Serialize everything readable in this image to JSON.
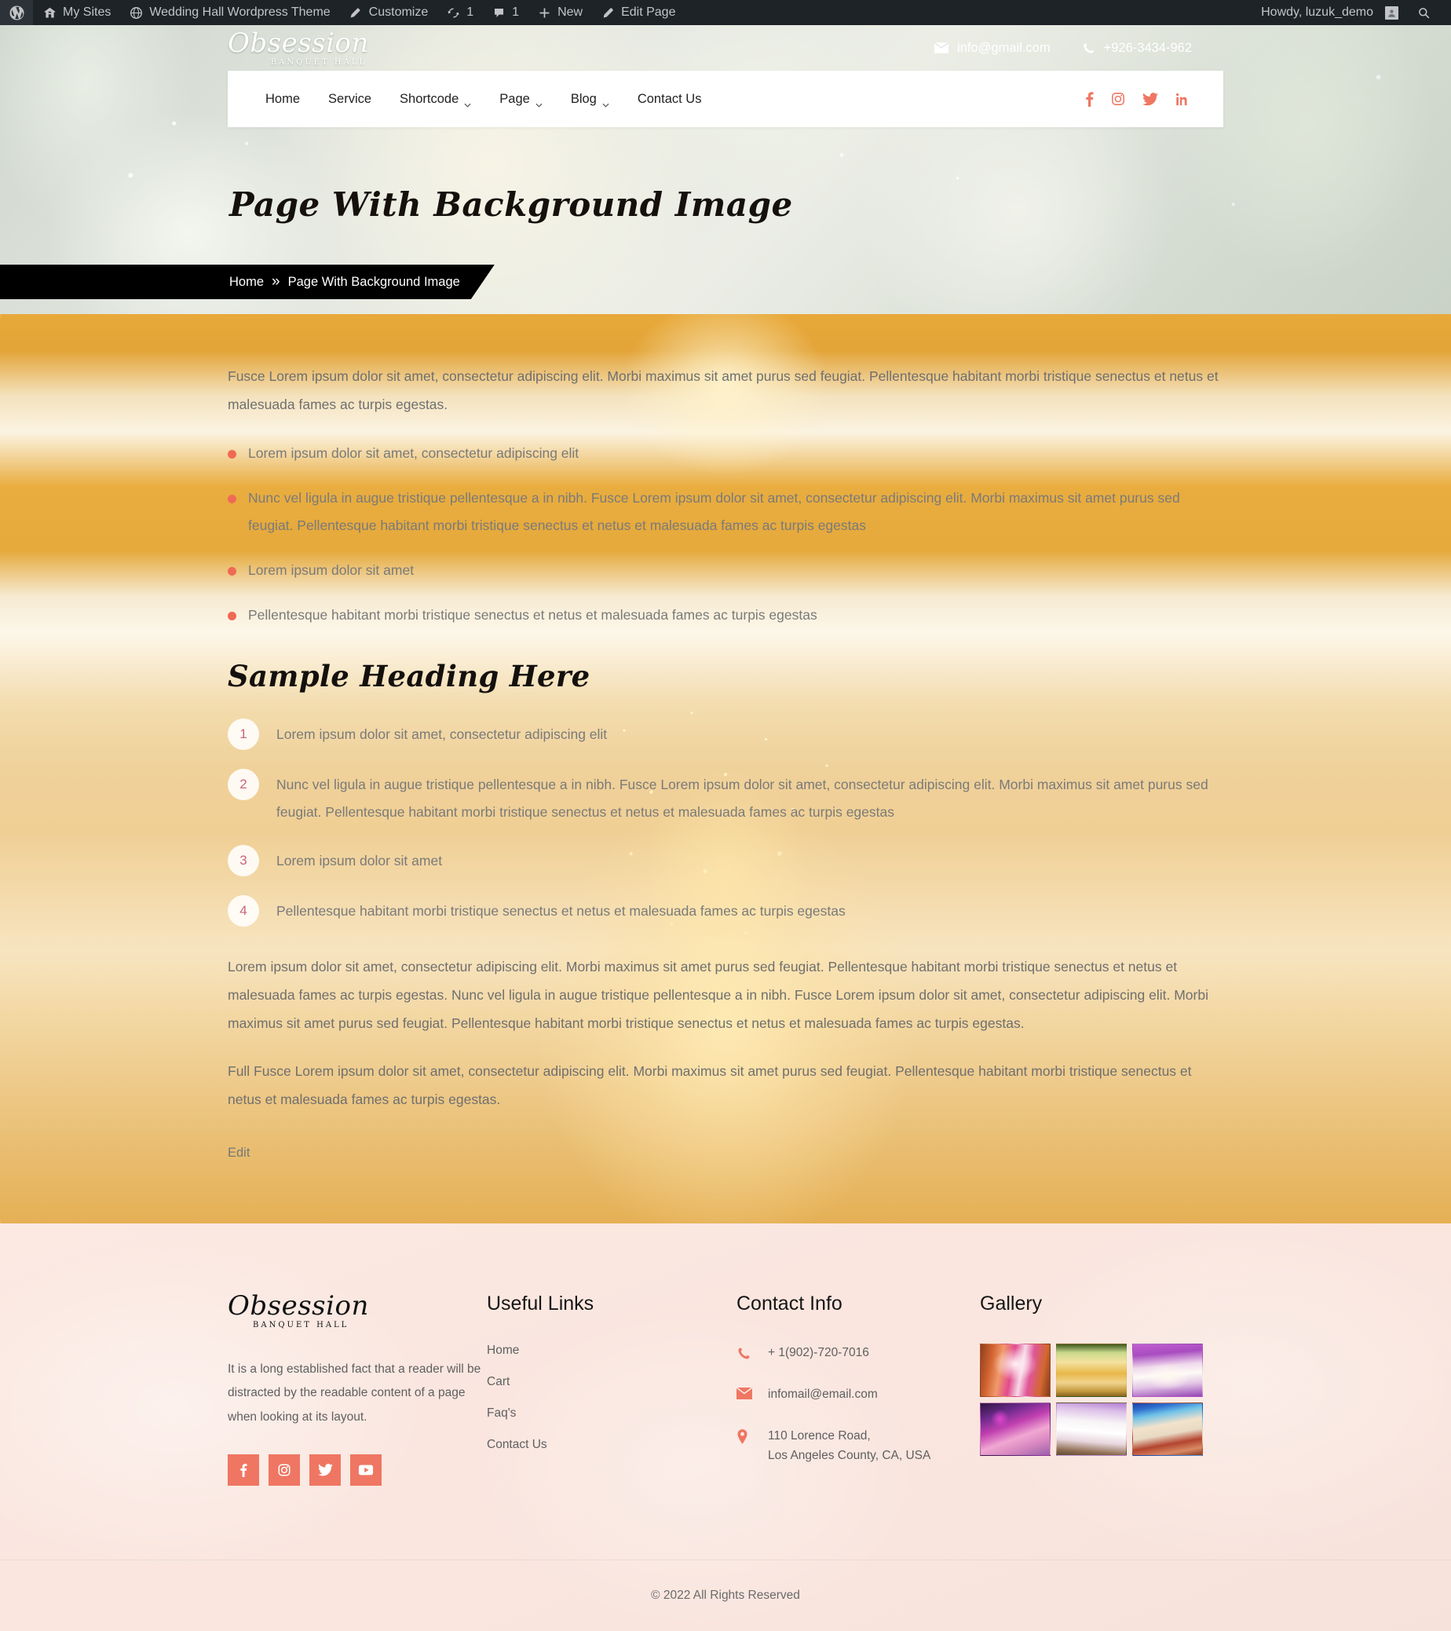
{
  "adminbar": {
    "items": [
      {
        "icon": "wordpress-icon",
        "label": ""
      },
      {
        "icon": "sites-icon",
        "label": "My Sites"
      },
      {
        "icon": "site-icon",
        "label": "Wedding Hall Wordpress Theme"
      },
      {
        "icon": "customize-icon",
        "label": "Customize"
      },
      {
        "icon": "updates-icon",
        "label": "1"
      },
      {
        "icon": "comments-icon",
        "label": "1"
      },
      {
        "icon": "plus-icon",
        "label": "New"
      },
      {
        "icon": "pencil-icon",
        "label": "Edit Page"
      }
    ],
    "howdy": "Howdy, luzuk_demo",
    "search_icon": "search-icon"
  },
  "header": {
    "logo_main": "Obsession",
    "logo_sub": "BANQUET HALL",
    "email": "info@gmail.com",
    "phone": "+926-3434-962",
    "menu": [
      {
        "label": "Home",
        "has_dropdown": false
      },
      {
        "label": "Service",
        "has_dropdown": false
      },
      {
        "label": "Shortcode",
        "has_dropdown": true
      },
      {
        "label": "Page",
        "has_dropdown": true
      },
      {
        "label": "Blog",
        "has_dropdown": true
      },
      {
        "label": "Contact Us",
        "has_dropdown": false
      }
    ],
    "social": [
      "facebook-icon",
      "instagram-icon",
      "twitter-icon",
      "linkedin-icon"
    ],
    "accent_color": "#ef7662"
  },
  "hero": {
    "title": "Page With Background Image",
    "breadcrumb_home": "Home",
    "breadcrumb_sep": "»",
    "breadcrumb_current": "Page With Background Image"
  },
  "main": {
    "intro": "Fusce Lorem ipsum dolor sit amet, consectetur adipiscing elit. Morbi maximus sit amet purus sed feugiat. Pellentesque habitant morbi tristique senectus et netus et malesuada fames ac turpis egestas.",
    "bullets": [
      "Lorem ipsum dolor sit amet, consectetur adipiscing elit",
      "Nunc vel ligula in augue tristique pellentesque a in nibh. Fusce Lorem ipsum dolor sit amet, consectetur adipiscing elit. Morbi maximus sit amet purus sed feugiat. Pellentesque habitant morbi tristique senectus et netus et malesuada fames ac turpis egestas",
      "Lorem ipsum dolor sit amet",
      "Pellentesque habitant morbi tristique senectus et netus et malesuada fames ac turpis egestas"
    ],
    "heading": "Sample Heading Here",
    "numbered": [
      {
        "n": "1",
        "text": "Lorem ipsum dolor sit amet, consectetur adipiscing elit"
      },
      {
        "n": "2",
        "text": "Nunc vel ligula in augue tristique pellentesque a in nibh. Fusce Lorem ipsum dolor sit amet, consectetur adipiscing elit. Morbi maximus sit amet purus sed feugiat. Pellentesque habitant morbi tristique senectus et netus et malesuada fames ac turpis egestas"
      },
      {
        "n": "3",
        "text": "Lorem ipsum dolor sit amet"
      },
      {
        "n": "4",
        "text": "Pellentesque habitant morbi tristique senectus et netus et malesuada fames ac turpis egestas"
      }
    ],
    "para_1": "Lorem ipsum dolor sit amet, consectetur adipiscing elit. Morbi maximus sit amet purus sed feugiat. Pellentesque habitant morbi tristique senectus et netus et malesuada fames ac turpis egestas. Nunc vel ligula in augue tristique pellentesque a in nibh. Fusce Lorem ipsum dolor sit amet, consectetur adipiscing elit. Morbi maximus sit amet purus sed feugiat. Pellentesque habitant morbi tristique senectus et netus et malesuada fames ac turpis egestas.",
    "para_2": "Full Fusce Lorem ipsum dolor sit amet, consectetur adipiscing elit. Morbi maximus sit amet purus sed feugiat. Pellentesque habitant morbi tristique senectus et netus et malesuada fames ac turpis egestas.",
    "edit": "Edit"
  },
  "footer": {
    "logo_main": "Obsession",
    "logo_sub": "BANQUET HALL",
    "description": "It is a long established fact that a reader will be distracted by the readable content of a page when looking at its layout.",
    "social": [
      "facebook-icon",
      "instagram-icon",
      "twitter-icon",
      "youtube-icon"
    ],
    "useful_links_title": "Useful Links",
    "useful_links": [
      "Home",
      "Cart",
      "Faq's",
      "Contact Us"
    ],
    "contact_title": "Contact Info",
    "contact": [
      {
        "icon": "phone-icon",
        "text": "+ 1(902)-720-7016"
      },
      {
        "icon": "mail-icon",
        "text": "infomail@email.com"
      },
      {
        "icon": "location-icon",
        "text": "110 Lorence Road,\nLos Angeles County, CA, USA"
      }
    ],
    "gallery_title": "Gallery",
    "gallery": [
      "gallery-image-1",
      "gallery-image-2",
      "gallery-image-3",
      "gallery-image-4",
      "gallery-image-5",
      "gallery-image-6"
    ],
    "copyright": "© 2022 All Rights Reserved",
    "accent_color": "#ef7662",
    "background_color": "#fae8e0"
  }
}
